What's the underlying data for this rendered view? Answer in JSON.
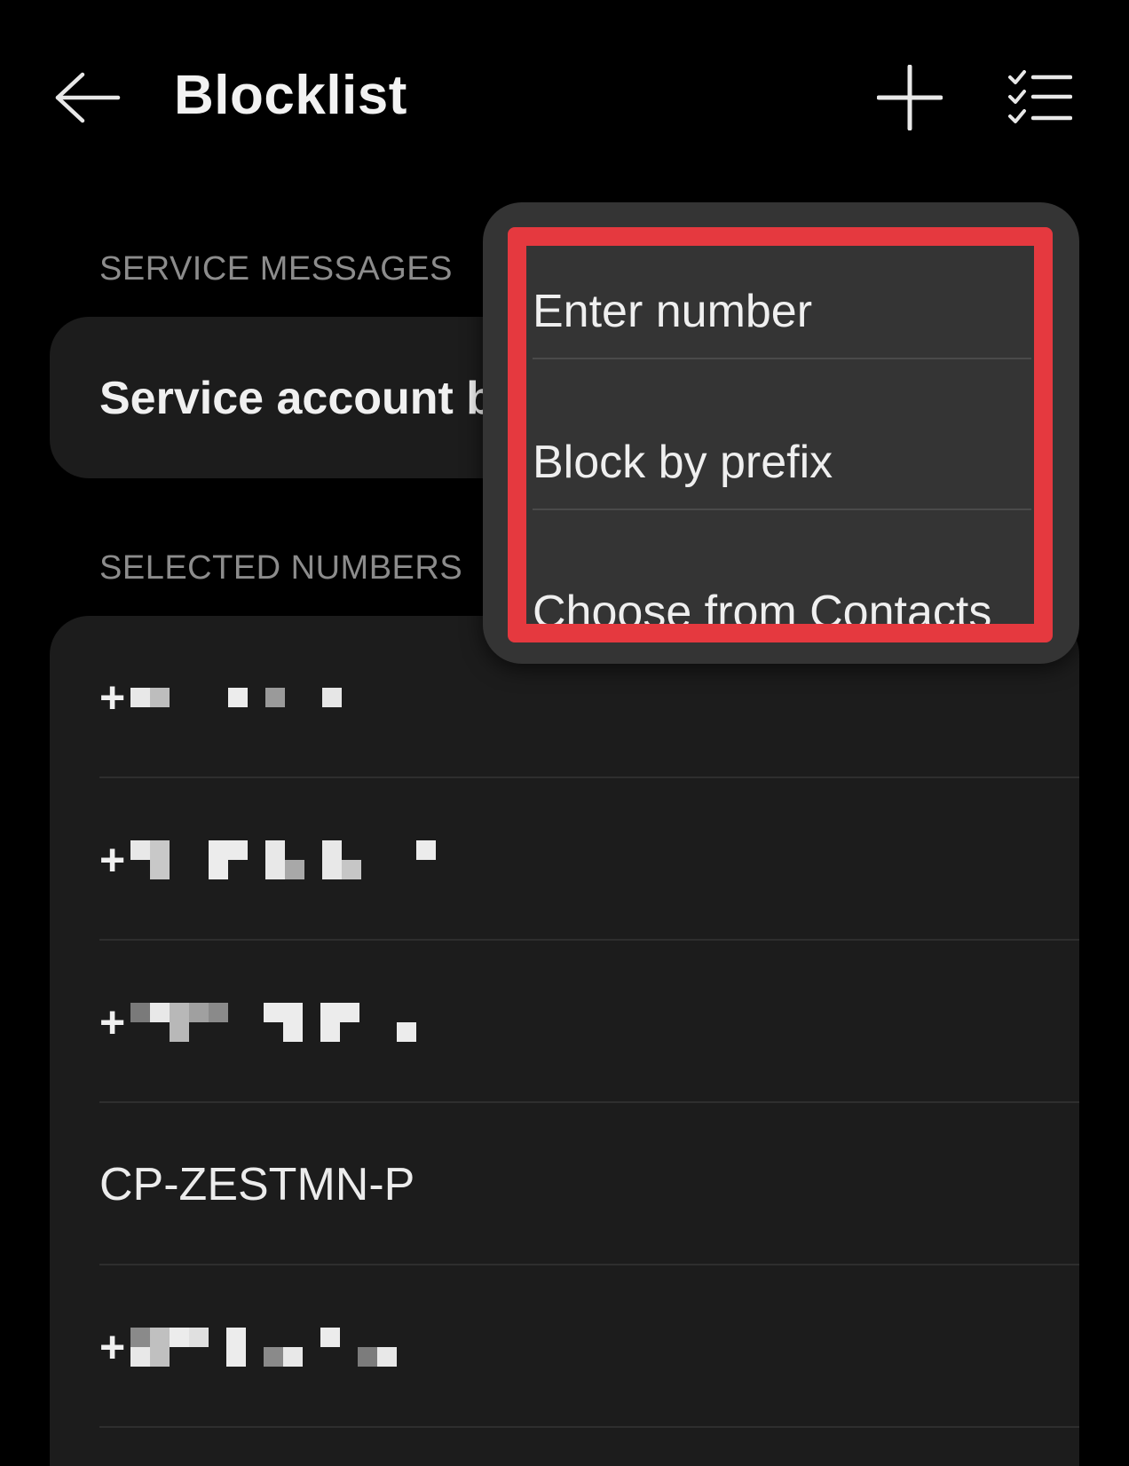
{
  "header": {
    "title": "Blocklist",
    "back_icon": "arrow-left-icon",
    "add_icon": "plus-icon",
    "multi_select_icon": "checklist-icon"
  },
  "sections": {
    "service_label": "SERVICE MESSAGES",
    "service_item": "Service account b",
    "numbers_label": "SELECTED NUMBERS"
  },
  "numbers": [
    {
      "prefix": "+",
      "masked": true
    },
    {
      "prefix": "+",
      "masked": true
    },
    {
      "prefix": "+",
      "masked": true
    },
    {
      "text": "CP-ZESTMN-P",
      "masked": false
    },
    {
      "prefix": "+",
      "masked": true
    }
  ],
  "popup_menu": {
    "items": [
      "Enter number",
      "Block by prefix",
      "Choose from Contacts"
    ],
    "highlight_color": "#e5393f"
  },
  "colors": {
    "background": "#000000",
    "card": "#1c1c1c",
    "popup": "#343434",
    "section_label": "#8c8c8c"
  }
}
